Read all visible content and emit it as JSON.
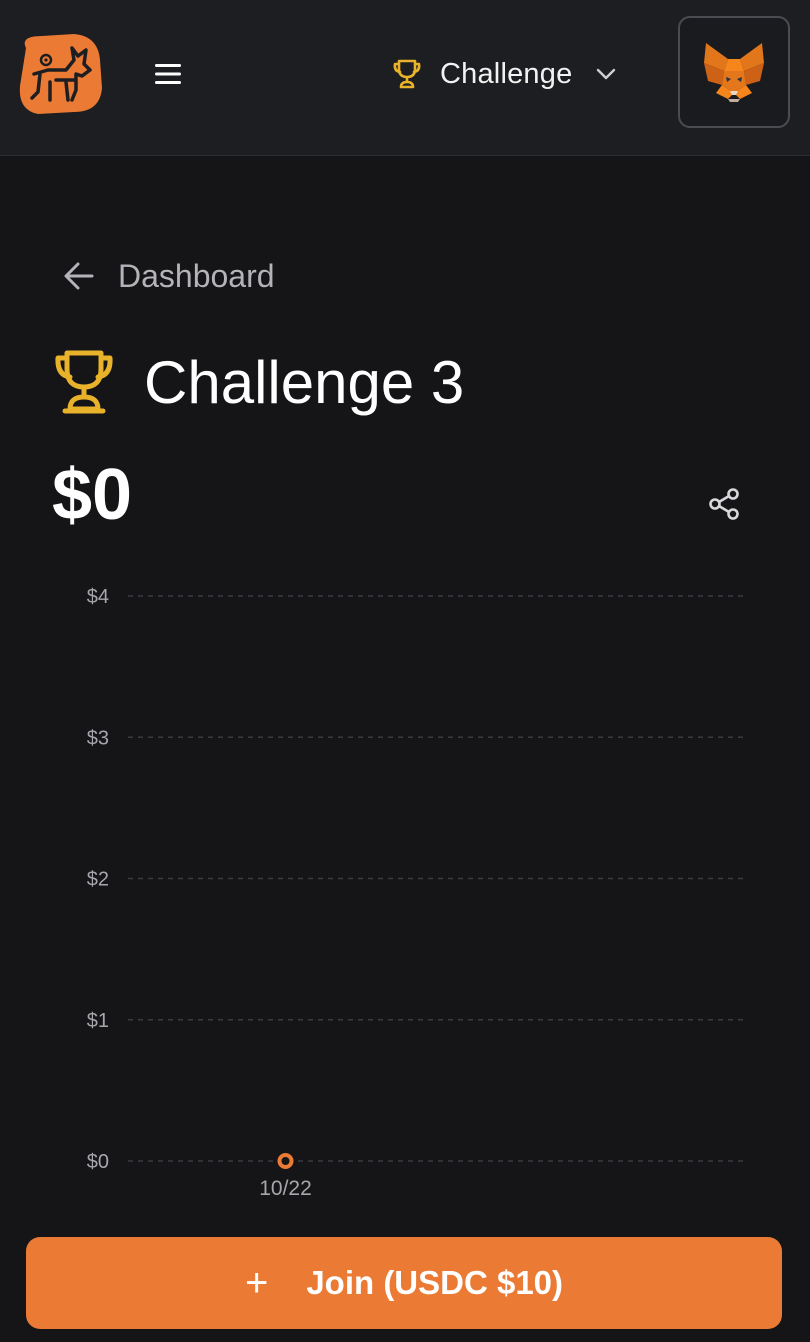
{
  "header": {
    "mode_label": "Challenge",
    "icons": {
      "logo": "app-logo-icon",
      "menu": "hamburger-menu-icon",
      "trophy": "trophy-icon",
      "chevron": "chevron-down-icon",
      "wallet": "metamask-fox-icon"
    }
  },
  "breadcrumb": {
    "back_label": "Dashboard"
  },
  "page": {
    "title": "Challenge 3",
    "balance": "$0"
  },
  "colors": {
    "accent": "#ea7a34",
    "trophy": "#e9b22b",
    "background": "#151517",
    "header_bg": "#1d1e21"
  },
  "chart_data": {
    "type": "line",
    "x": [
      "10/22"
    ],
    "values": [
      0
    ],
    "ylim": [
      0,
      4
    ],
    "yticks": [
      0,
      1,
      2,
      3,
      4
    ],
    "ytick_labels": [
      "$0",
      "$1",
      "$2",
      "$3",
      "$4"
    ],
    "grid": true,
    "legend": "none"
  },
  "actions": {
    "join_label": "Join (USDC $10)",
    "join_icon": "+"
  }
}
